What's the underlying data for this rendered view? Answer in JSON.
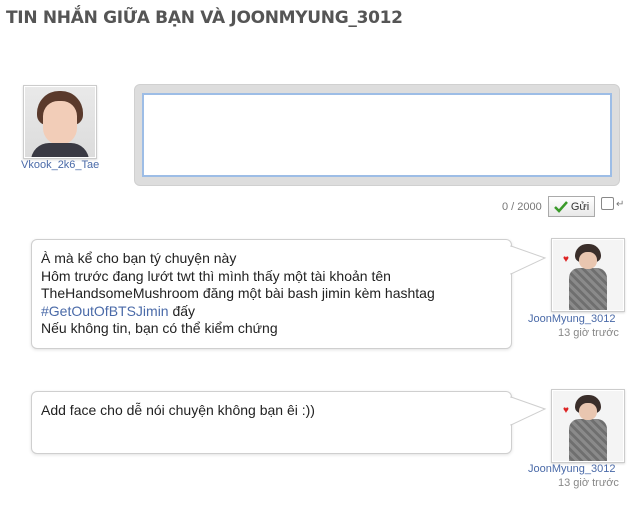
{
  "page": {
    "title": "TIN NHẮN GIỮA BẠN VÀ JOONMYUNG_3012"
  },
  "composer": {
    "username": "Vkook_2k6_Tae",
    "textarea_value": "",
    "counter": "0 / 2000",
    "send_label": "Gửi",
    "enter_to_send_checked": false,
    "icons": [
      "check-icon",
      "enter-icon"
    ]
  },
  "messages": [
    {
      "lines": [
        "À mà kể cho bạn tý chuyện này",
        "Hôm trước đang lướt twt thì mình thấy một tài khoản tên",
        "TheHandsomeMushroom đăng một bài bash jimin kèm hashtag"
      ],
      "hashtag": "#GetOutOfBTSJimin",
      "hashtag_suffix": " đấy",
      "last_line": "Nếu không tin, bạn có thể kiểm chứng",
      "sender": "JoonMyung_3012",
      "time": "13 giờ trước"
    },
    {
      "text": "Add face cho dễ nói chuyện không bạn êi :))",
      "sender": "JoonMyung_3012",
      "time": "13 giờ trước"
    }
  ],
  "colors": {
    "accent": "#9dbde6",
    "link": "#4a6aa8",
    "check": "#3a9a2a"
  }
}
